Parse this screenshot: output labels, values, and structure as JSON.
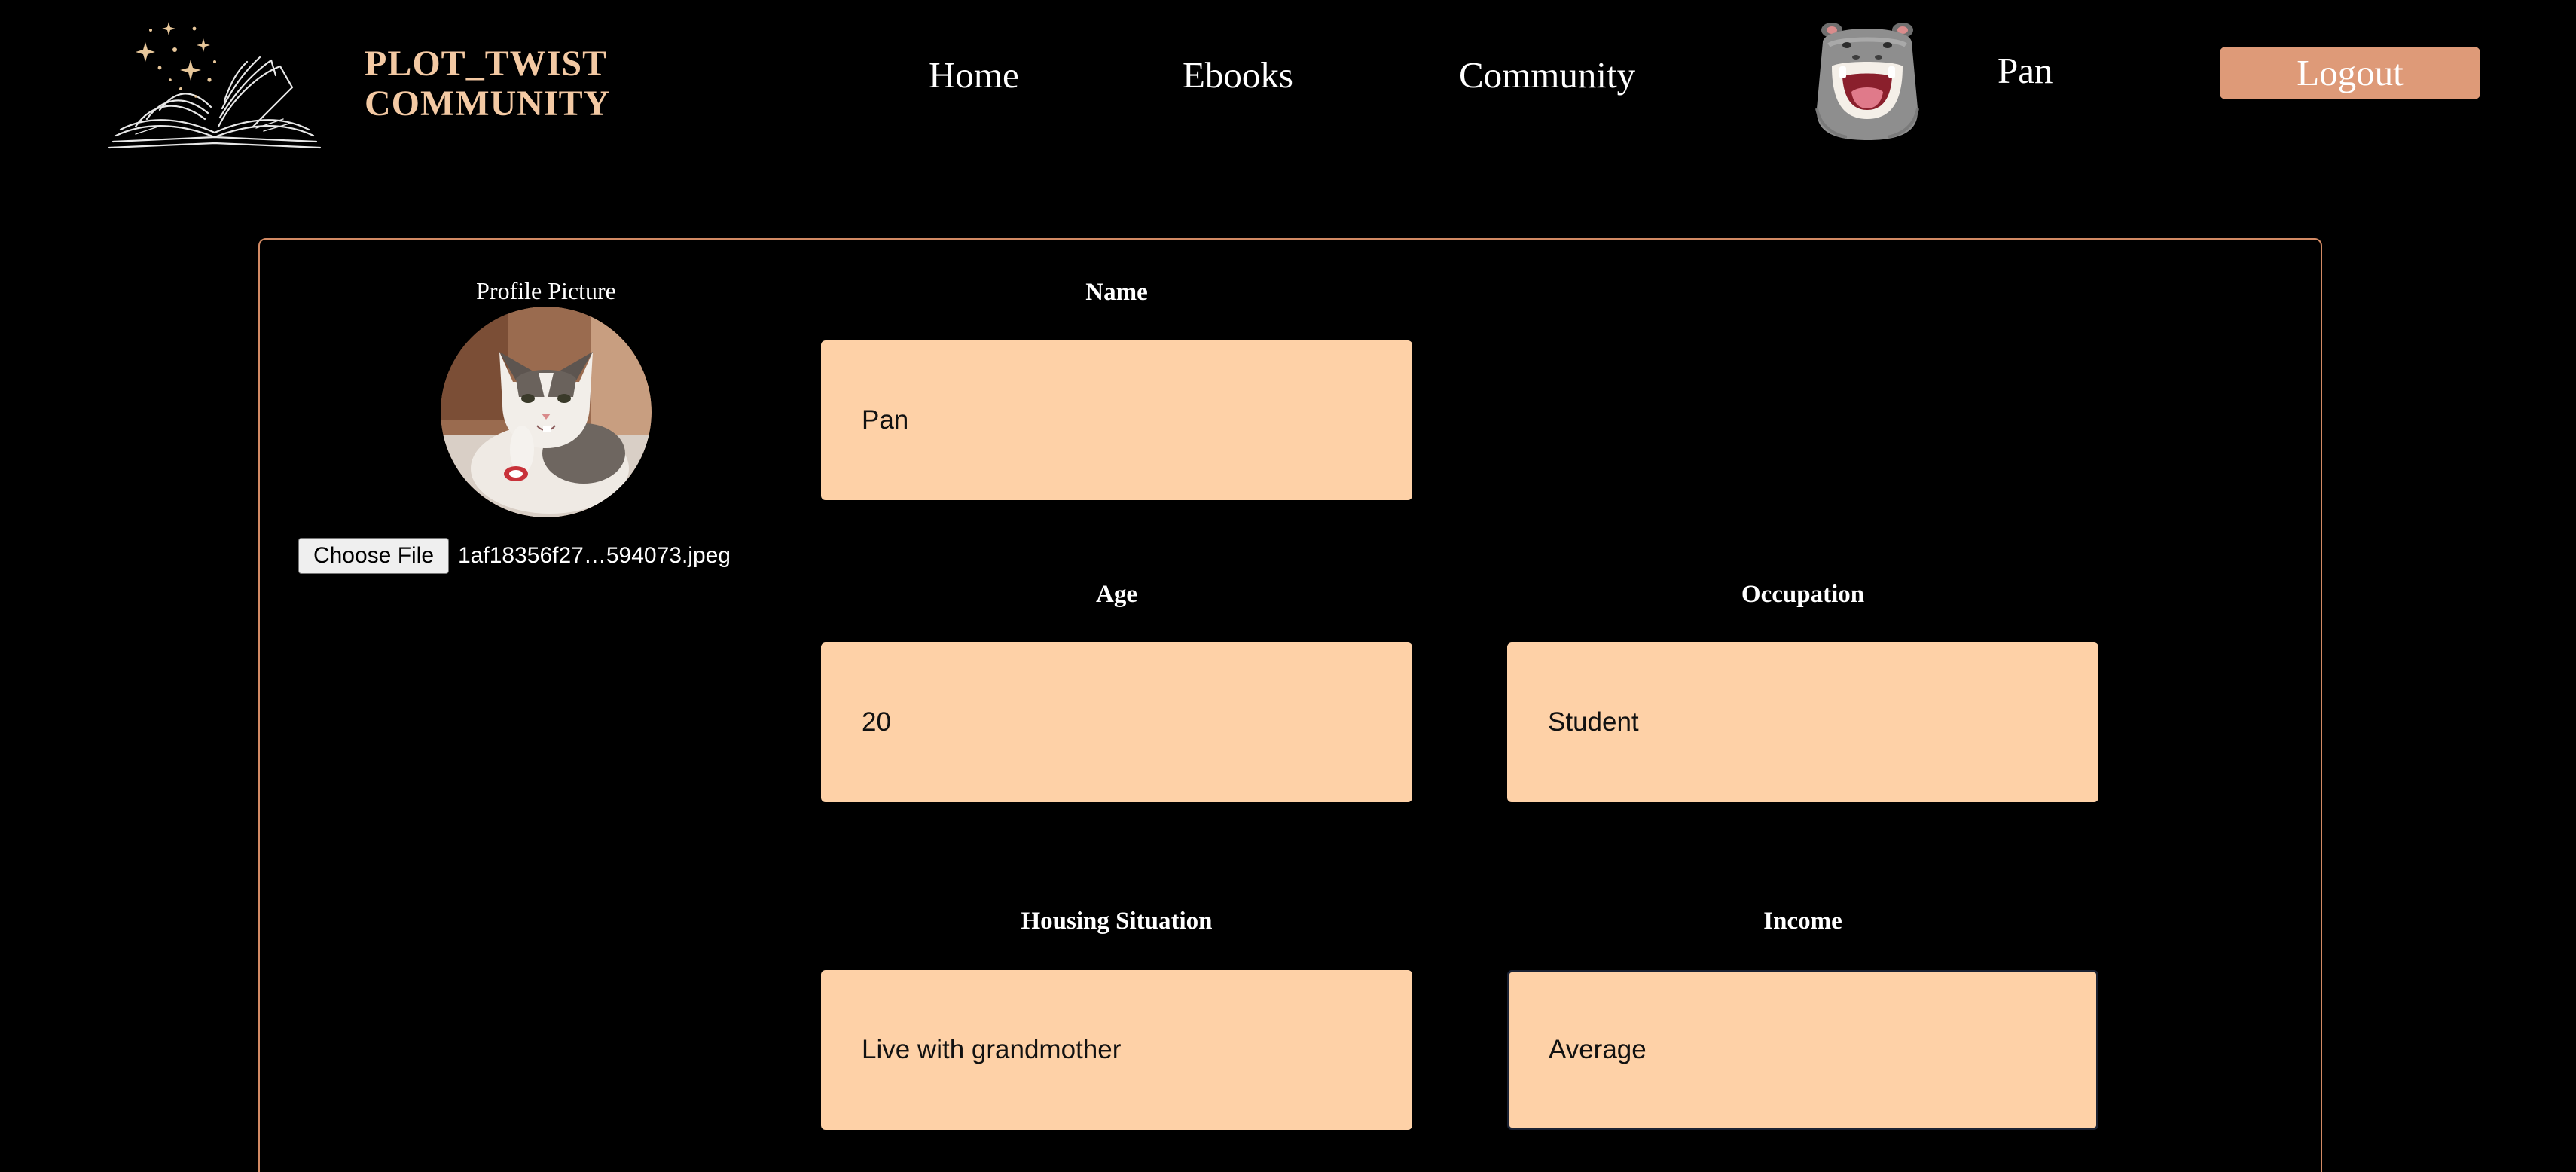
{
  "header": {
    "brand_line1": "PLOT_TWIST",
    "brand_line2": "COMMUNITY",
    "logo_icon": "open-book-sparkles-icon",
    "nav": {
      "home": "Home",
      "ebooks": "Ebooks",
      "community": "Community"
    },
    "user_avatar_icon": "hippo-avatar-icon",
    "user_name": "Pan",
    "logout_label": "Logout"
  },
  "profile": {
    "picture_label": "Profile Picture",
    "picture_icon": "cat-photo",
    "choose_file_label": "Choose File",
    "file_name": "1af18356f27…594073.jpeg",
    "fields": {
      "name": {
        "label": "Name",
        "value": "Pan"
      },
      "age": {
        "label": "Age",
        "value": "20"
      },
      "occupation": {
        "label": "Occupation",
        "value": "Student"
      },
      "housing": {
        "label": "Housing Situation",
        "value": "Live with grandmother"
      },
      "income": {
        "label": "Income",
        "value": "Average"
      }
    }
  },
  "colors": {
    "background": "#000000",
    "brand_text": "#f3c9a3",
    "logout_button": "#de9a78",
    "card_border": "#d28a64",
    "input_fill": "#fed1a7",
    "focused_border": "#1b2233"
  }
}
